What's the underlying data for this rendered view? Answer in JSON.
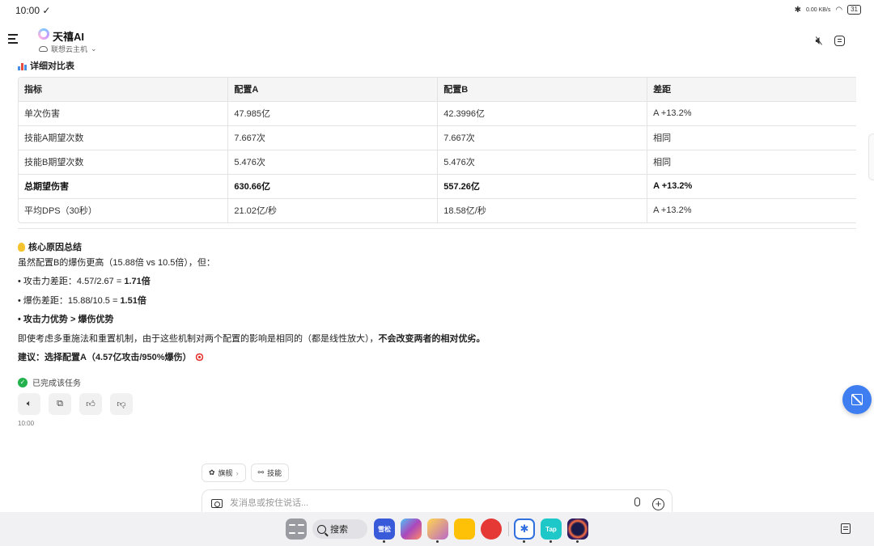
{
  "status": {
    "time": "10:00 ✓",
    "battery": "31",
    "network": "0.00 KB/s"
  },
  "header": {
    "title": "天禧AI",
    "subtitle": "联想云主机",
    "subtitle_caret": "⌄"
  },
  "section": {
    "heading": "详细对比表"
  },
  "table": {
    "headers": [
      "指标",
      "配置A",
      "配置B",
      "差距"
    ],
    "rows": [
      [
        "单次伤害",
        "47.985亿",
        "42.3996亿",
        "A +13.2%"
      ],
      [
        "技能A期望次数",
        "7.667次",
        "7.667次",
        "相同"
      ],
      [
        "技能B期望次数",
        "5.476次",
        "5.476次",
        "相同"
      ],
      [
        "总期望伤害",
        "630.66亿",
        "557.26亿",
        "A +13.2%"
      ],
      [
        "平均DPS（30秒）",
        "21.02亿/秒",
        "18.58亿/秒",
        "A +13.2%"
      ]
    ]
  },
  "summary": {
    "heading": "核心原因总结",
    "intro": "虽然配置B的爆伤更高（15.88倍 vs 10.5倍），但：",
    "bullet1_prefix": "• 攻击力差距：4.57/2.67 = ",
    "bullet1_value": "1.71倍",
    "bullet2_prefix": "• 爆伤差距：15.88/10.5 = ",
    "bullet2_value": "1.51倍",
    "bullet3": "• 攻击力优势 > 爆伤优势",
    "conclusion_prefix": "即使考虑多重施法和重置机制，由于这些机制对两个配置的影响是相同的（都是线性放大），",
    "conclusion_bold": "不会改变两者的相对优劣。",
    "advice": "建议：选择配置A（4.57亿攻击/950%爆伤）"
  },
  "task": {
    "done_label": "已完成该任务",
    "check_icon": "✓",
    "time": "10:00"
  },
  "chips": {
    "chip1": "旗舰",
    "chip1_caret": "›",
    "chip2": "技能"
  },
  "input": {
    "placeholder": "发消息或按住说话..."
  },
  "dock": {
    "search_label": "搜索",
    "app2_label": "雪松",
    "app9_label": "Tap"
  }
}
